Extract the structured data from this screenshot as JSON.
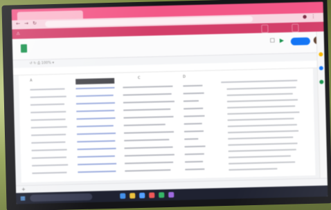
{
  "browser": {
    "tabs": [
      "",
      "",
      ""
    ],
    "url": ""
  },
  "banner": {
    "text": "",
    "button_1": "",
    "button_2": ""
  },
  "app": {
    "title": "",
    "menus": [],
    "share_label": ""
  },
  "sheet": {
    "columns": [
      [],
      [],
      [],
      []
    ],
    "tab_label": ""
  },
  "taskbar": {
    "search_placeholder": "",
    "time": "",
    "date": ""
  },
  "colors": {
    "accent": "#e85a86",
    "banner": "#c94168",
    "share": "#1a73e8",
    "sheets_green": "#1f8f4f",
    "taskbar": "#1f2230",
    "background_wall": "#8e9e4d"
  },
  "icons": [
    "back-icon",
    "forward-icon",
    "reload-icon",
    "sheets-icon",
    "comment-icon",
    "meet-icon",
    "avatar",
    "search-icon",
    "windows-icon",
    "taskbar-app-icons",
    "sidebar-icons"
  ]
}
